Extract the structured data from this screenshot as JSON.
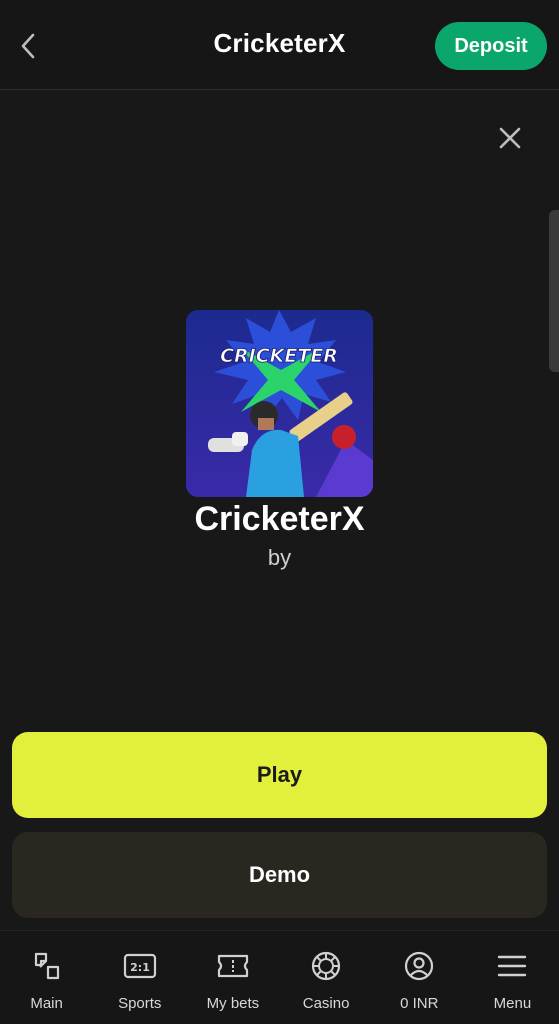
{
  "header": {
    "title": "CricketerX",
    "deposit_label": "Deposit"
  },
  "game": {
    "name": "CricketerX",
    "by_label": "by",
    "logo_text": "CRICKETER"
  },
  "actions": {
    "play_label": "Play",
    "demo_label": "Demo"
  },
  "nav": {
    "items": [
      {
        "label": "Main",
        "icon": "main-icon"
      },
      {
        "label": "Sports",
        "icon": "sports-icon"
      },
      {
        "label": "My bets",
        "icon": "ticket-icon"
      },
      {
        "label": "Casino",
        "icon": "casino-chip-icon"
      },
      {
        "label": "0 INR",
        "icon": "account-icon"
      },
      {
        "label": "Menu",
        "icon": "menu-icon"
      }
    ],
    "sports_badge": "2:1"
  },
  "colors": {
    "background": "#181818",
    "deposit": "#0aa66b",
    "play": "#e2f03c",
    "demo": "#2a2620"
  }
}
